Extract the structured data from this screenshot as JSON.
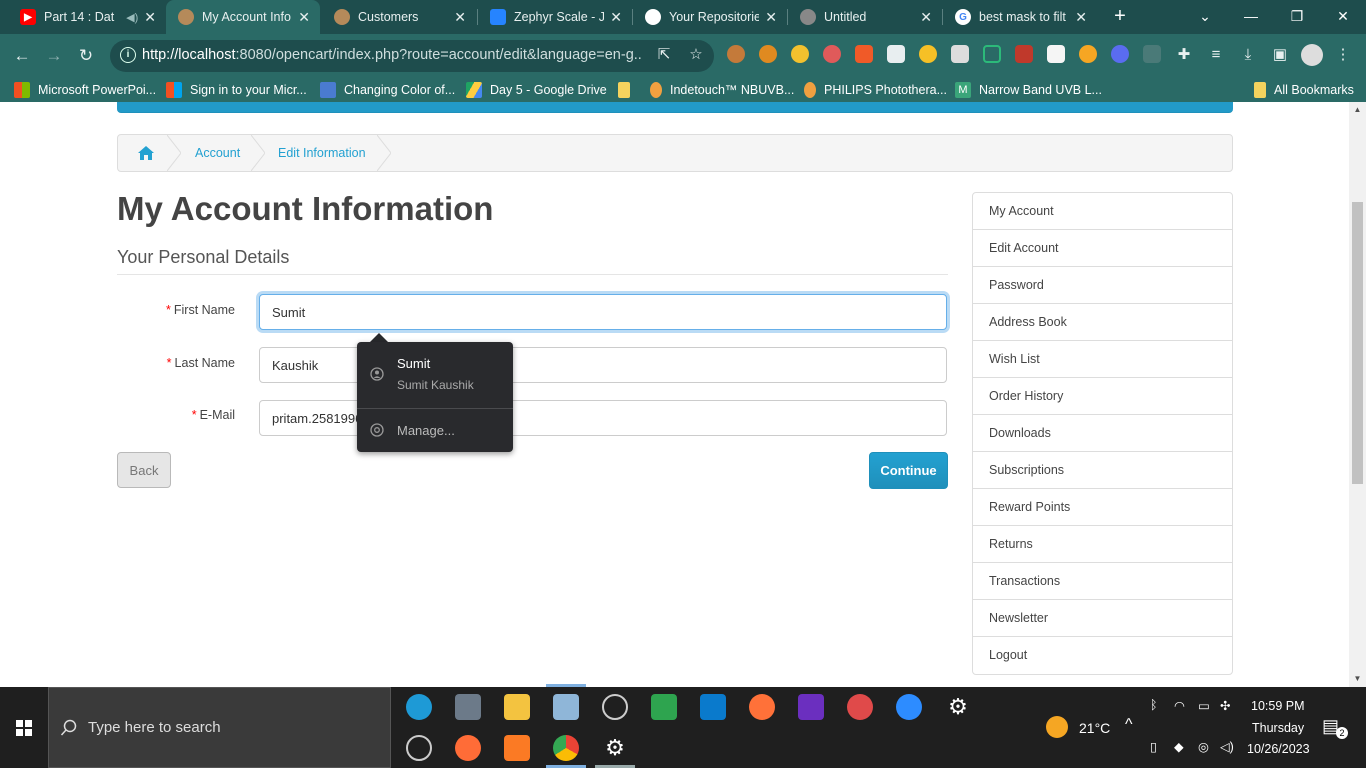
{
  "browser": {
    "tabs": [
      {
        "label": "Part 14 : Dat",
        "icon": "youtube-icon",
        "color": "#ff0000",
        "active": false
      },
      {
        "label": "My Account Info",
        "icon": "opencart-icon",
        "color": "#b58a5a",
        "active": true
      },
      {
        "label": "Customers",
        "icon": "opencart-icon",
        "color": "#b58a5a",
        "active": false
      },
      {
        "label": "Zephyr Scale - Ji",
        "icon": "jira-icon",
        "color": "#2684ff",
        "active": false
      },
      {
        "label": "Your Repositorie",
        "icon": "github-icon",
        "color": "#000000",
        "active": false
      },
      {
        "label": "Untitled",
        "icon": "globe-icon",
        "color": "#777777",
        "active": false
      },
      {
        "label": "best mask to filt",
        "icon": "google-icon",
        "color": "#4285f4",
        "active": false
      }
    ],
    "url_host": "http://localhost",
    "url_rest": ":8080/opencart/index.php?route=account/edit&language=en-g...",
    "bookmarks": [
      {
        "label": "Microsoft PowerPoi...",
        "icon": "microsoft-icon",
        "color": "#f25022"
      },
      {
        "label": "Sign in to your Micr...",
        "icon": "microsoft-icon",
        "color": "#f25022"
      },
      {
        "label": "Changing Color of...",
        "icon": "bookmark-u-icon",
        "color": "#4a7bd0"
      },
      {
        "label": "Day 5 - Google Drive",
        "icon": "drive-icon",
        "color": "#1fa463"
      },
      {
        "label": "",
        "icon": "folder-icon",
        "color": "#f4d35e"
      },
      {
        "label": "Indetouch™ NBUVB...",
        "icon": "pin-icon",
        "color": "#f0a040"
      },
      {
        "label": "PHILIPS Photothera...",
        "icon": "pin-icon",
        "color": "#f0a040"
      },
      {
        "label": "Narrow Band UVB L...",
        "icon": "m-icon",
        "color": "#3aa57a"
      }
    ],
    "all_bookmarks": "All Bookmarks"
  },
  "breadcrumb": {
    "items": [
      "Account",
      "Edit Information"
    ]
  },
  "page": {
    "title": "My Account Information",
    "legend": "Your Personal Details",
    "fields": [
      {
        "label": "First Name",
        "value": "Sumit"
      },
      {
        "label": "Last Name",
        "value": "Kaushik"
      },
      {
        "label": "E-Mail",
        "value": "pritam.2581996"
      }
    ],
    "back": "Back",
    "continue": "Continue"
  },
  "autofill": {
    "main": "Sumit",
    "sub": "Sumit Kaushik",
    "manage": "Manage..."
  },
  "sidebar": {
    "items": [
      "My Account",
      "Edit Account",
      "Password",
      "Address Book",
      "Wish List",
      "Order History",
      "Downloads",
      "Subscriptions",
      "Reward Points",
      "Returns",
      "Transactions",
      "Newsletter",
      "Logout"
    ]
  },
  "taskbar": {
    "search_placeholder": "Type here to search",
    "weather": "21°C",
    "time": "10:59 PM",
    "day": "Thursday",
    "date": "10/26/2023",
    "notifications": "2"
  },
  "colors": {
    "accent": "#229ac8",
    "link": "#23a1d1",
    "chrome": "#2a6a66"
  }
}
